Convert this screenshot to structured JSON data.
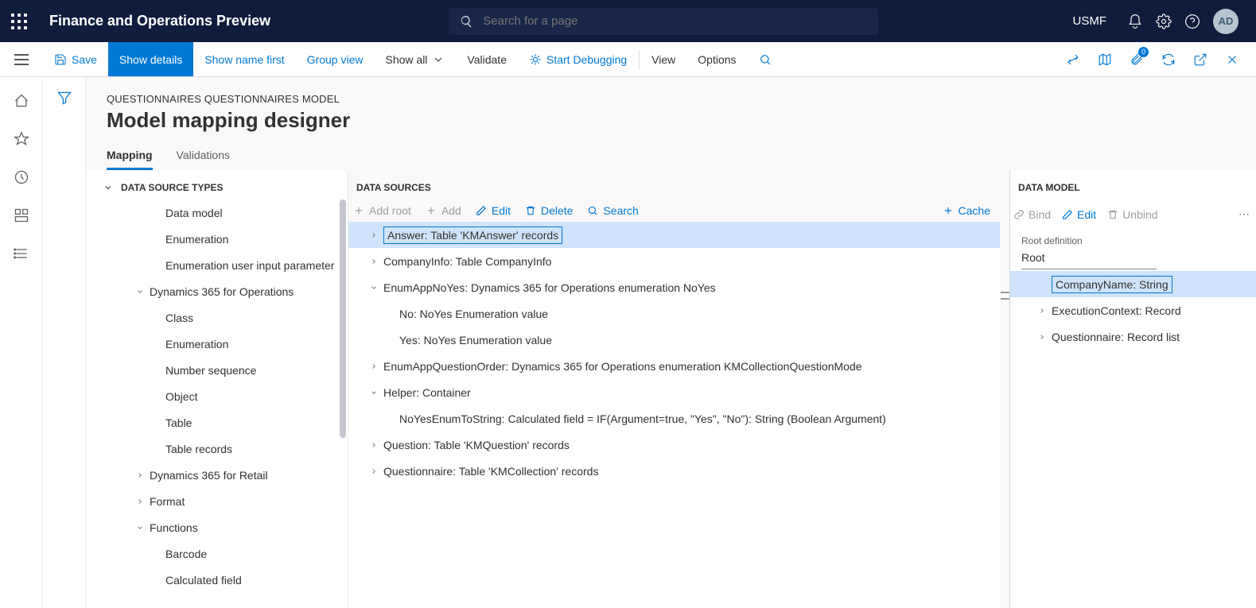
{
  "topbar": {
    "title": "Finance and Operations Preview",
    "search_placeholder": "Search for a page",
    "company": "USMF",
    "avatar": "AD"
  },
  "toolbar": {
    "save": "Save",
    "show_details": "Show details",
    "show_name_first": "Show name first",
    "group_view": "Group view",
    "show_all": "Show all",
    "validate": "Validate",
    "start_debugging": "Start Debugging",
    "view": "View",
    "options": "Options",
    "badge_count": "0"
  },
  "page": {
    "breadcrumb": "QUESTIONNAIRES QUESTIONNAIRES MODEL",
    "title": "Model mapping designer",
    "tabs": {
      "mapping": "Mapping",
      "validations": "Validations"
    }
  },
  "types": {
    "header": "DATA SOURCE TYPES",
    "nodes": [
      {
        "label": "Data model",
        "indent": 3,
        "caret": "none"
      },
      {
        "label": "Enumeration",
        "indent": 3,
        "caret": "none"
      },
      {
        "label": "Enumeration user input parameter",
        "indent": 3,
        "caret": "none"
      },
      {
        "label": "Dynamics 365 for Operations",
        "indent": 2,
        "caret": "down"
      },
      {
        "label": "Class",
        "indent": 3,
        "caret": "none"
      },
      {
        "label": "Enumeration",
        "indent": 3,
        "caret": "none"
      },
      {
        "label": "Number sequence",
        "indent": 3,
        "caret": "none"
      },
      {
        "label": "Object",
        "indent": 3,
        "caret": "none"
      },
      {
        "label": "Table",
        "indent": 3,
        "caret": "none"
      },
      {
        "label": "Table records",
        "indent": 3,
        "caret": "none"
      },
      {
        "label": "Dynamics 365 for Retail",
        "indent": 2,
        "caret": "right"
      },
      {
        "label": "Format",
        "indent": 2,
        "caret": "right"
      },
      {
        "label": "Functions",
        "indent": 2,
        "caret": "down"
      },
      {
        "label": "Barcode",
        "indent": 3,
        "caret": "none"
      },
      {
        "label": "Calculated field",
        "indent": 3,
        "caret": "none"
      }
    ]
  },
  "sources": {
    "header": "DATA SOURCES",
    "buttons": {
      "add_root": "Add root",
      "add": "Add",
      "edit": "Edit",
      "delete": "Delete",
      "search": "Search",
      "cache": "Cache"
    },
    "nodes": [
      {
        "label": "Answer: Table 'KMAnswer' records",
        "indent": 1,
        "caret": "right",
        "selected": true
      },
      {
        "label": "CompanyInfo: Table CompanyInfo",
        "indent": 1,
        "caret": "right"
      },
      {
        "label": "EnumAppNoYes: Dynamics 365 for Operations enumeration NoYes",
        "indent": 1,
        "caret": "down"
      },
      {
        "label": "No: NoYes Enumeration value",
        "indent": 2,
        "caret": "none"
      },
      {
        "label": "Yes: NoYes Enumeration value",
        "indent": 2,
        "caret": "none"
      },
      {
        "label": "EnumAppQuestionOrder: Dynamics 365 for Operations enumeration KMCollectionQuestionMode",
        "indent": 1,
        "caret": "right"
      },
      {
        "label": "Helper: Container",
        "indent": 1,
        "caret": "down"
      },
      {
        "label": "NoYesEnumToString: Calculated field = IF(Argument=true, \"Yes\", \"No\"): String (Boolean Argument)",
        "indent": 2,
        "caret": "none"
      },
      {
        "label": "Question: Table 'KMQuestion' records",
        "indent": 1,
        "caret": "right"
      },
      {
        "label": "Questionnaire: Table 'KMCollection' records",
        "indent": 1,
        "caret": "right"
      }
    ]
  },
  "datamodel": {
    "header": "DATA MODEL",
    "buttons": {
      "bind": "Bind",
      "edit": "Edit",
      "unbind": "Unbind"
    },
    "root_label": "Root definition",
    "root_value": "Root",
    "nodes": [
      {
        "label": "CompanyName: String",
        "indent": 1,
        "caret": "none",
        "selected": true
      },
      {
        "label": "ExecutionContext: Record",
        "indent": 1,
        "caret": "right"
      },
      {
        "label": "Questionnaire: Record list",
        "indent": 1,
        "caret": "right"
      }
    ]
  }
}
